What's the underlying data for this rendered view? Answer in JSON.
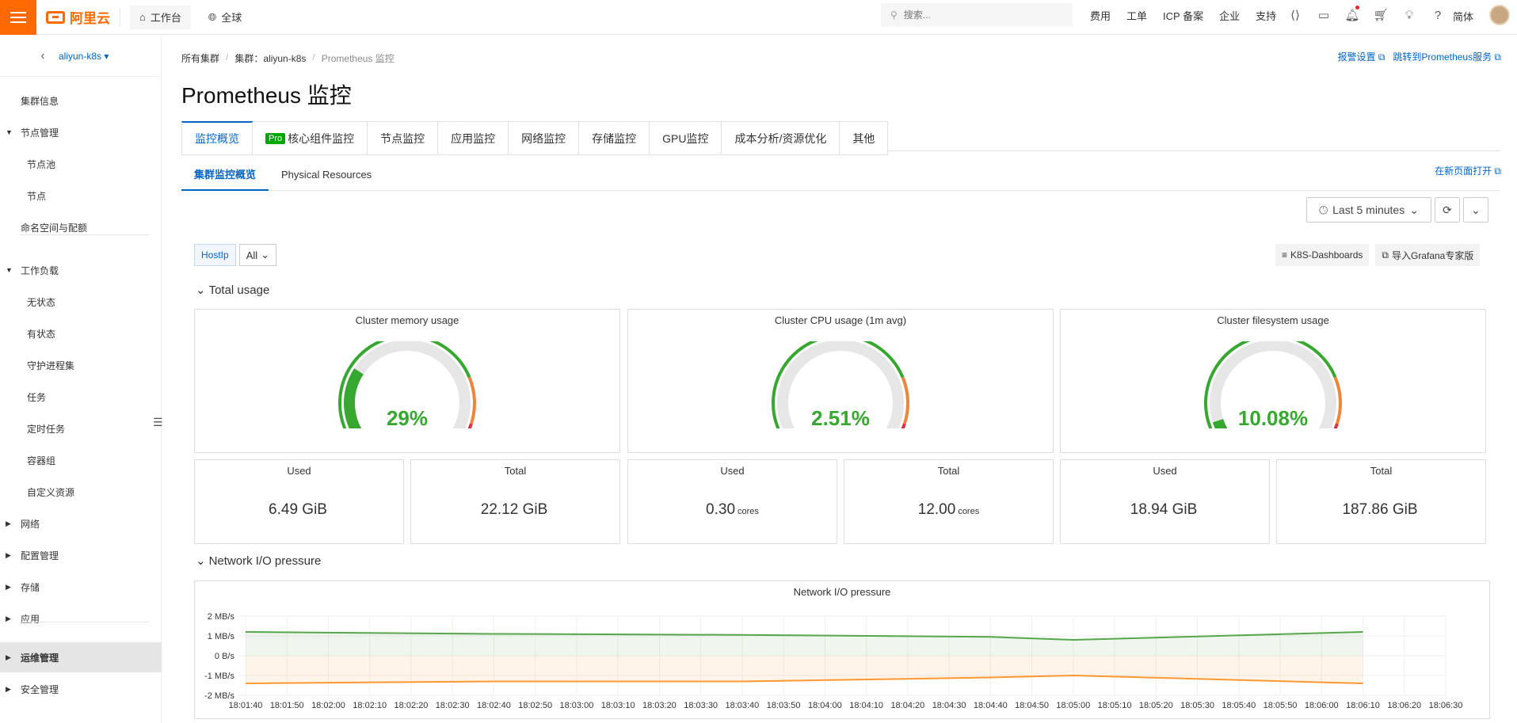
{
  "topbar": {
    "brand": "阿里云",
    "workbench": "工作台",
    "region": "全球",
    "search_placeholder": "搜索...",
    "links": [
      "费用",
      "工单",
      "ICP 备案",
      "企业",
      "支持"
    ],
    "lang": "简体"
  },
  "sidebar": {
    "cluster": "aliyun-k8s",
    "items": [
      {
        "label": "集群信息",
        "indent": false,
        "tri": ""
      },
      {
        "label": "节点管理",
        "indent": false,
        "tri": "▼"
      },
      {
        "label": "节点池",
        "indent": true,
        "tri": ""
      },
      {
        "label": "节点",
        "indent": true,
        "tri": ""
      },
      {
        "label": "命名空间与配额",
        "indent": false,
        "tri": ""
      },
      {
        "label": "工作负载",
        "indent": false,
        "tri": "▼"
      },
      {
        "label": "无状态",
        "indent": true,
        "tri": ""
      },
      {
        "label": "有状态",
        "indent": true,
        "tri": ""
      },
      {
        "label": "守护进程集",
        "indent": true,
        "tri": ""
      },
      {
        "label": "任务",
        "indent": true,
        "tri": ""
      },
      {
        "label": "定时任务",
        "indent": true,
        "tri": ""
      },
      {
        "label": "容器组",
        "indent": true,
        "tri": ""
      },
      {
        "label": "自定义资源",
        "indent": true,
        "tri": ""
      },
      {
        "label": "网络",
        "indent": false,
        "tri": "▶"
      },
      {
        "label": "配置管理",
        "indent": false,
        "tri": "▶"
      },
      {
        "label": "存储",
        "indent": false,
        "tri": "▶"
      },
      {
        "label": "应用",
        "indent": false,
        "tri": "▶"
      },
      {
        "label": "运维管理",
        "indent": false,
        "tri": "▶",
        "active": true
      },
      {
        "label": "安全管理",
        "indent": false,
        "tri": "▶"
      }
    ]
  },
  "breadcrumb": {
    "all": "所有集群",
    "cluster": "集群：aliyun-k8s",
    "current": "Prometheus 监控"
  },
  "actions": {
    "alert": "报警设置",
    "jump": "跳转到Prometheus服务",
    "newpage": "在新页面打开"
  },
  "title": "Prometheus 监控",
  "tabs": [
    "监控概览",
    "核心组件监控",
    "节点监控",
    "应用监控",
    "网络监控",
    "存储监控",
    "GPU监控",
    "成本分析/资源优化",
    "其他"
  ],
  "pro_badge": "Pro",
  "subtabs": [
    "集群监控概览",
    "Physical Resources"
  ],
  "time": {
    "range": "Last 5 minutes"
  },
  "variable": {
    "label": "HostIp",
    "value": "All"
  },
  "dashlinks": {
    "k8s": "K8S-Dashboards",
    "grafana": "导入Grafana专家版"
  },
  "rows": {
    "total": "Total usage",
    "network": "Network I/O pressure"
  },
  "gauges": [
    {
      "title": "Cluster memory usage",
      "value": "29%",
      "fraction": 0.29
    },
    {
      "title": "Cluster CPU usage (1m avg)",
      "value": "2.51%",
      "fraction": 0.0251
    },
    {
      "title": "Cluster filesystem usage",
      "value": "10.08%",
      "fraction": 0.1008
    }
  ],
  "stats": [
    {
      "title": "Used",
      "value": "6.49 GiB",
      "unit": ""
    },
    {
      "title": "Total",
      "value": "22.12 GiB",
      "unit": ""
    },
    {
      "title": "Used",
      "value": "0.30",
      "unit": "cores"
    },
    {
      "title": "Total",
      "value": "12.00",
      "unit": "cores"
    },
    {
      "title": "Used",
      "value": "18.94 GiB",
      "unit": ""
    },
    {
      "title": "Total",
      "value": "187.86 GiB",
      "unit": ""
    }
  ],
  "net": {
    "title": "Network I/O pressure",
    "ylabels": [
      "2 MB/s",
      "1 MB/s",
      "0 B/s",
      "-1 MB/s",
      "-2 MB/s"
    ],
    "xlabels": [
      "18:01:40",
      "18:01:50",
      "18:02:00",
      "18:02:10",
      "18:02:20",
      "18:02:30",
      "18:02:40",
      "18:02:50",
      "18:03:00",
      "18:03:10",
      "18:03:20",
      "18:03:30",
      "18:03:40",
      "18:03:50",
      "18:04:00",
      "18:04:10",
      "18:04:20",
      "18:04:30",
      "18:04:40",
      "18:04:50",
      "18:05:00",
      "18:05:10",
      "18:05:20",
      "18:05:30",
      "18:05:40",
      "18:05:50",
      "18:06:00",
      "18:06:10",
      "18:06:20",
      "18:06:30"
    ]
  },
  "chart_data": {
    "type": "area",
    "x": [
      "18:01:40",
      "18:02:40",
      "18:03:40",
      "18:04:40",
      "18:05:00",
      "18:06:10"
    ],
    "series": [
      {
        "values": [
          1.2,
          1.1,
          1.05,
          0.95,
          0.8,
          1.2
        ]
      },
      {
        "values": [
          -1.4,
          -1.3,
          -1.3,
          -1.1,
          -1.0,
          -1.4
        ]
      }
    ],
    "ylim": [
      -2,
      2
    ],
    "grid": true
  }
}
